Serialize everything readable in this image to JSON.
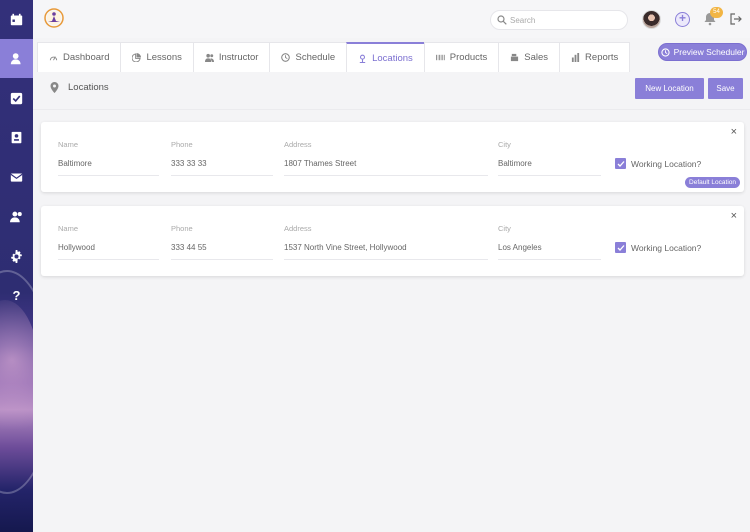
{
  "sidebar": {
    "items": [
      {
        "icon": "calendar-icon"
      },
      {
        "icon": "user-pin-icon",
        "active": true
      },
      {
        "icon": "checkbox-icon"
      },
      {
        "icon": "contact-card-icon"
      },
      {
        "icon": "mail-icon"
      },
      {
        "icon": "users-icon"
      },
      {
        "icon": "gear-icon"
      },
      {
        "icon": "help-icon",
        "label": "?"
      }
    ]
  },
  "topbar": {
    "search_placeholder": "Search",
    "notification_count": "54"
  },
  "tabs": [
    {
      "label": "Dashboard",
      "icon": "gauge-icon"
    },
    {
      "label": "Lessons",
      "icon": "pie-icon"
    },
    {
      "label": "Instructor",
      "icon": "users-icon"
    },
    {
      "label": "Schedule",
      "icon": "clock-icon"
    },
    {
      "label": "Locations",
      "icon": "pin-icon",
      "active": true
    },
    {
      "label": "Products",
      "icon": "barcode-icon"
    },
    {
      "label": "Sales",
      "icon": "register-icon"
    },
    {
      "label": "Reports",
      "icon": "bar-chart-icon"
    }
  ],
  "preview_button": "Preview Scheduler",
  "page": {
    "title": "Locations",
    "new_location": "New Location",
    "save": "Save"
  },
  "field_labels": {
    "name": "Name",
    "phone": "Phone",
    "address": "Address",
    "city": "City",
    "working": "Working Location?"
  },
  "locations": [
    {
      "name": "Baltimore",
      "phone": "333 33 33",
      "address": "1807 Thames Street",
      "city": "Baltimore",
      "working": true,
      "default_badge": "Default Location"
    },
    {
      "name": "Hollywood",
      "phone": "333 44 55",
      "address": "1537 North Vine Street, Hollywood",
      "city": "Los Angeles",
      "working": true
    }
  ],
  "colors": {
    "accent": "#8a7fd8",
    "badge": "#f2b544"
  }
}
